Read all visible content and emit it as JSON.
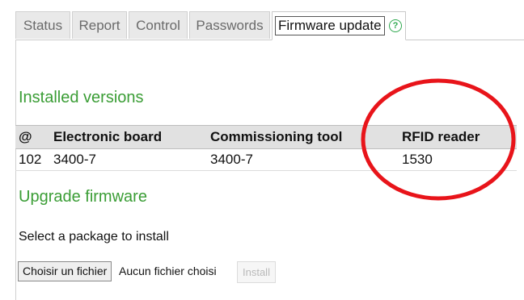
{
  "tabs": [
    {
      "label": "Status",
      "active": false
    },
    {
      "label": "Report",
      "active": false
    },
    {
      "label": "Control",
      "active": false
    },
    {
      "label": "Passwords",
      "active": false
    },
    {
      "label": "Firmware update",
      "active": true
    }
  ],
  "help_icon": {
    "glyph": "?",
    "color": "#2fa84f"
  },
  "installed": {
    "title": "Installed versions",
    "columns": [
      "@",
      "Electronic board",
      "Commissioning tool",
      "RFID reader"
    ],
    "rows": [
      [
        "102",
        "3400-7",
        "3400-7",
        "1530"
      ]
    ]
  },
  "upgrade": {
    "title": "Upgrade firmware",
    "instruction": "Select a package to install",
    "choose_file_label": "Choisir un fichier",
    "file_status": "Aucun fichier choisi",
    "install_label": "Install",
    "install_enabled": false
  },
  "annotation": {
    "shape": "ellipse",
    "color": "#e8141a"
  },
  "colors": {
    "accent": "#3a9d35",
    "header_bg": "#e1e1e1"
  }
}
